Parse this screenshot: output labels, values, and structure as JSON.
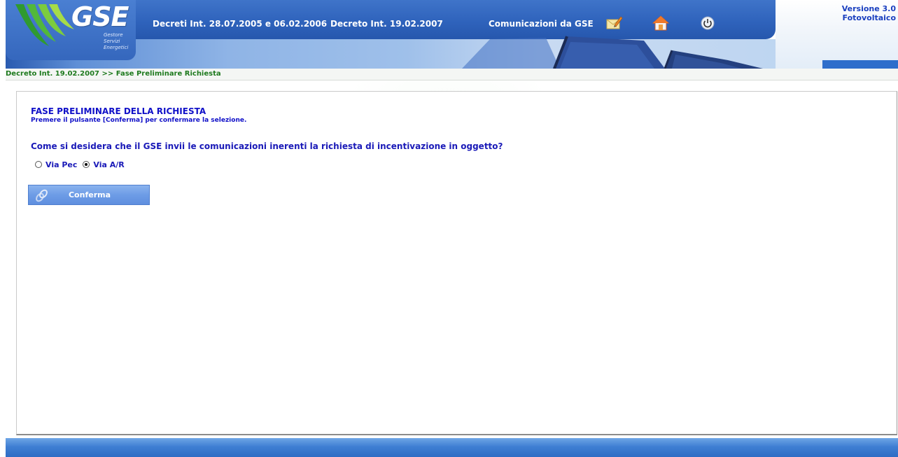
{
  "header": {
    "logo": {
      "text": "GSE",
      "subtitle_lines": [
        "Gestore",
        "Servizi",
        "Energetici"
      ]
    },
    "nav": [
      {
        "label": "Decreti Int. 28.07.2005 e 06.02.2006"
      },
      {
        "label": "Decreto Int. 19.02.2007"
      },
      {
        "label": "Comunicazioni da GSE"
      }
    ],
    "icons": [
      "mail-edit-icon",
      "home-icon",
      "power-icon"
    ],
    "version": {
      "line1": "Versione 3.0",
      "line2": "Fotovoltaico"
    }
  },
  "breadcrumb": "Decreto Int. 19.02.2007 >> Fase Preliminare Richiesta",
  "main": {
    "title": "FASE PRELIMINARE DELLA RICHIESTA",
    "subtitle": "Premere il pulsante [Conferma] per confermare la selezione.",
    "question": "Come si desidera che il GSE invii le comunicazioni inerenti la richiesta di incentivazione in oggetto?",
    "options": [
      {
        "label": "Via Pec",
        "checked": false
      },
      {
        "label": "Via A/R",
        "checked": true
      }
    ],
    "confirm_label": "Conferma"
  },
  "colors": {
    "header_blue": "#2f63bc",
    "link_blue": "#1a1ab8",
    "breadcrumb_green": "#1e7a1e",
    "version_blue": "#1a3fbf"
  }
}
